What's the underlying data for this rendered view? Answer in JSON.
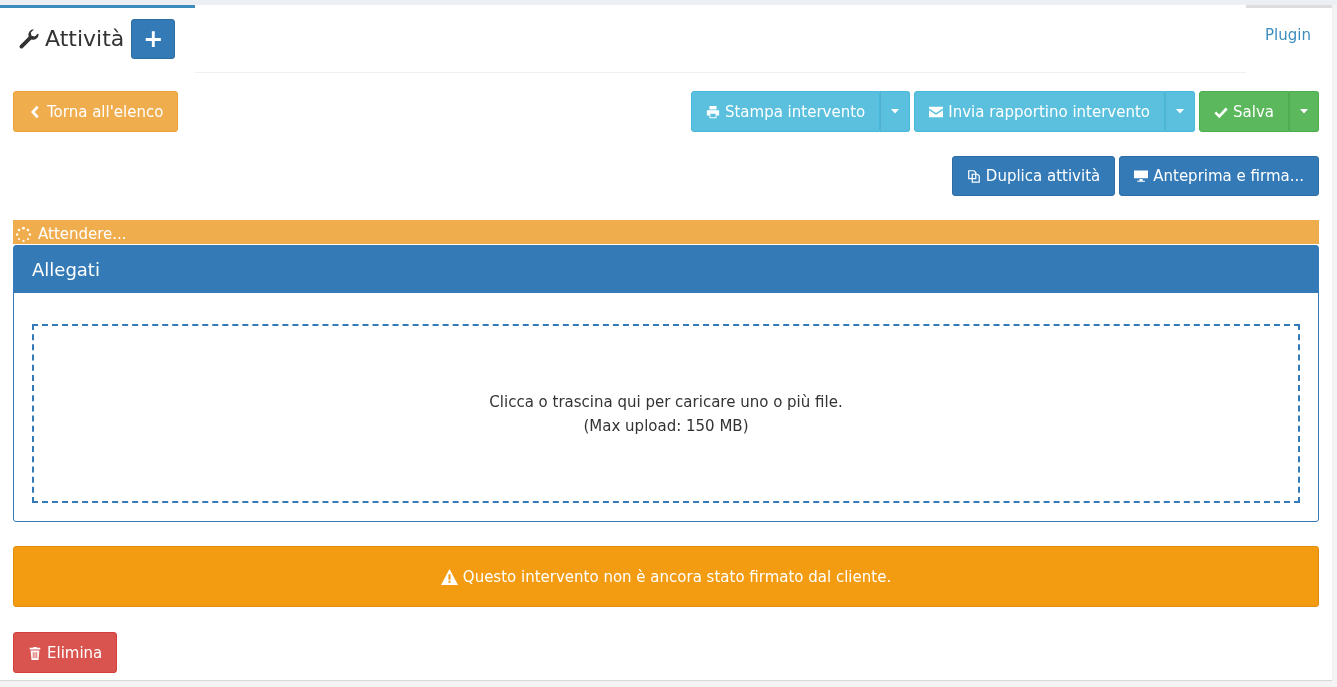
{
  "tabs": [
    {
      "label": "Attività",
      "selected": true
    },
    {
      "label": "Plugin",
      "selected": false
    }
  ],
  "add_button": {
    "label": "+"
  },
  "back_button": {
    "label": "Torna all'elenco"
  },
  "print_button": {
    "label": "Stampa intervento"
  },
  "send_button": {
    "label": "Invia rapportino intervento"
  },
  "save_button": {
    "label": "Salva"
  },
  "duplicate_button": {
    "label": "Duplica attività"
  },
  "preview_button": {
    "label": "Anteprima e firma..."
  },
  "loading_bar": {
    "label": "Attendere..."
  },
  "attachments": {
    "title": "Allegati",
    "dropzone_lines": [
      "Clicca o trascina qui per caricare uno o più file.",
      "(Max upload: 150 MB)"
    ]
  },
  "alert": {
    "text": "Questo intervento non è ancora stato firmato dal cliente."
  },
  "delete_button": {
    "label": "Elimina"
  }
}
